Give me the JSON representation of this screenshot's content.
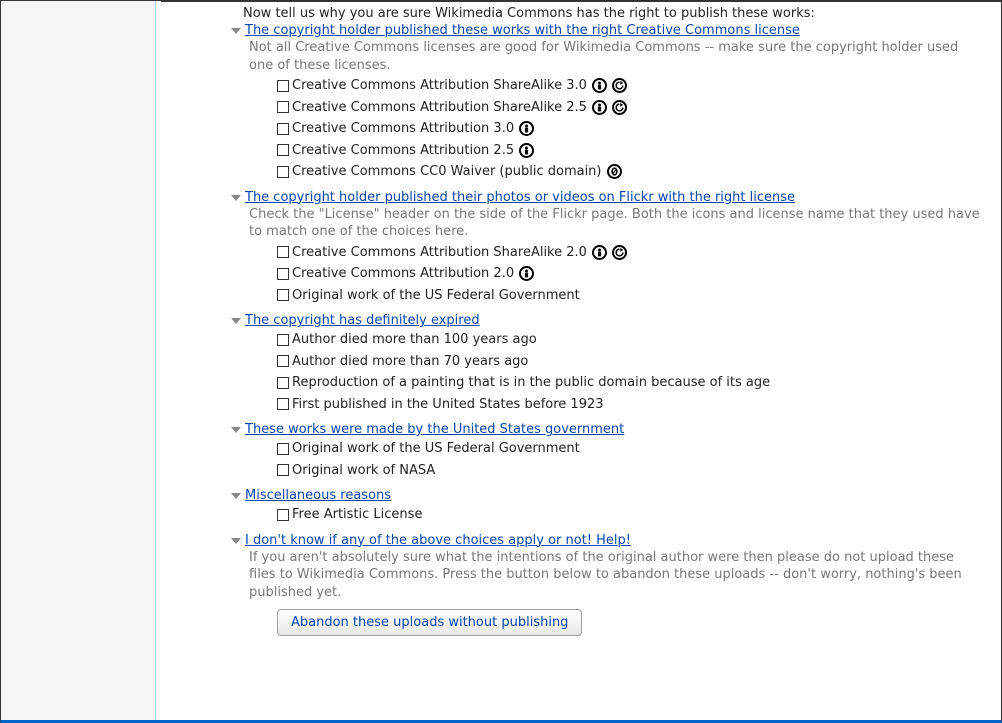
{
  "prompt": "Now tell us why you are sure Wikimedia Commons has the right to publish these works:",
  "sections": [
    {
      "title": "The copyright holder published these works with the right Creative Commons license",
      "desc": "Not all Creative Commons licenses are good for Wikimedia Commons -- make sure the copyright holder used one of these licenses.",
      "options": [
        {
          "label": "Creative Commons Attribution ShareAlike 3.0",
          "icons": [
            "by",
            "sa"
          ]
        },
        {
          "label": "Creative Commons Attribution ShareAlike 2.5",
          "icons": [
            "by",
            "sa"
          ]
        },
        {
          "label": "Creative Commons Attribution 3.0",
          "icons": [
            "by"
          ]
        },
        {
          "label": "Creative Commons Attribution 2.5",
          "icons": [
            "by"
          ]
        },
        {
          "label": "Creative Commons CC0 Waiver (public domain)",
          "icons": [
            "zero"
          ]
        }
      ]
    },
    {
      "title": "The copyright holder published their photos or videos on Flickr with the right license",
      "desc": "Check the \"License\" header on the side of the Flickr page. Both the icons and license name that they used have to match one of the choices here.",
      "options": [
        {
          "label": "Creative Commons Attribution ShareAlike 2.0",
          "icons": [
            "by",
            "sa"
          ]
        },
        {
          "label": "Creative Commons Attribution 2.0",
          "icons": [
            "by"
          ]
        },
        {
          "label": "Original work of the US Federal Government",
          "icons": []
        }
      ]
    },
    {
      "title": "The copyright has definitely expired",
      "desc": "",
      "options": [
        {
          "label": "Author died more than 100 years ago",
          "icons": []
        },
        {
          "label": "Author died more than 70 years ago",
          "icons": []
        },
        {
          "label": "Reproduction of a painting that is in the public domain because of its age",
          "icons": []
        },
        {
          "label": "First published in the United States before 1923",
          "icons": []
        }
      ]
    },
    {
      "title": "These works were made by the United States government",
      "desc": "",
      "options": [
        {
          "label": "Original work of the US Federal Government",
          "icons": []
        },
        {
          "label": "Original work of NASA",
          "icons": []
        }
      ]
    },
    {
      "title": "Miscellaneous reasons",
      "desc": "",
      "options": [
        {
          "label": "Free Artistic License",
          "icons": []
        }
      ]
    },
    {
      "title": "I don't know if any of the above choices apply or not! Help!",
      "desc": "If you aren't absolutely sure what the intentions of the original author were then please do not upload these files to Wikimedia Commons. Press the button below to abandon these uploads -- don't worry, nothing's been published yet.",
      "options": [],
      "button": "Abandon these uploads without publishing"
    }
  ]
}
